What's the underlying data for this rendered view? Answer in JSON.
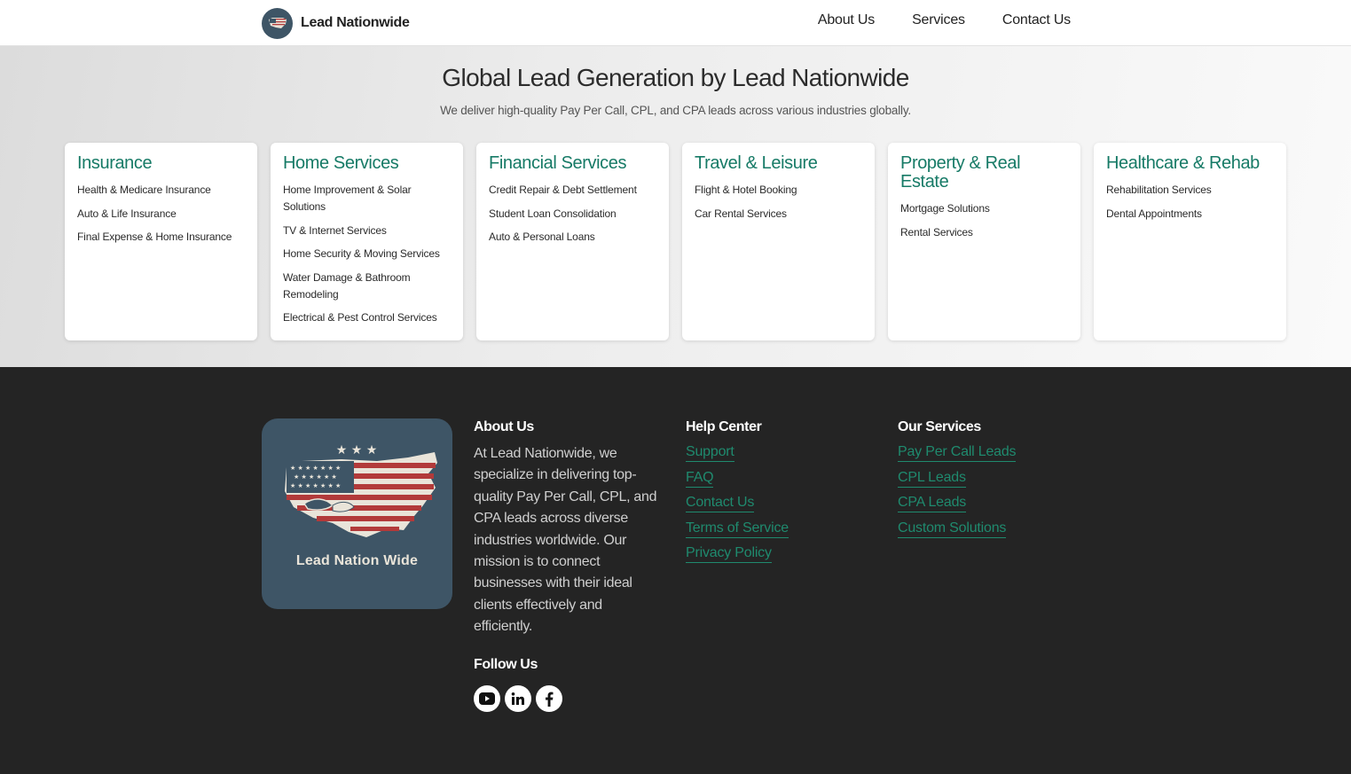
{
  "header": {
    "brand": "Lead Nationwide",
    "nav": [
      "About Us",
      "Services",
      "Contact Us"
    ]
  },
  "hero": {
    "title": "Global Lead Generation by Lead Nationwide",
    "subtitle": "We deliver high-quality Pay Per Call, CPL, and CPA leads across various industries globally."
  },
  "cards": [
    {
      "title": "Insurance",
      "items": [
        "Health & Medicare Insurance",
        "Auto & Life Insurance",
        "Final Expense & Home Insurance"
      ]
    },
    {
      "title": "Home Services",
      "items": [
        "Home Improvement & Solar Solutions",
        "TV & Internet Services",
        "Home Security & Moving Services",
        "Water Damage & Bathroom Remodeling",
        "Electrical & Pest Control Services"
      ]
    },
    {
      "title": "Financial Services",
      "items": [
        "Credit Repair & Debt Settlement",
        "Student Loan Consolidation",
        "Auto & Personal Loans"
      ]
    },
    {
      "title": "Travel & Leisure",
      "items": [
        "Flight & Hotel Booking",
        "Car Rental Services"
      ]
    },
    {
      "title": "Property & Real Estate",
      "items": [
        "Mortgage Solutions",
        "Rental Services"
      ]
    },
    {
      "title": "Healthcare & Rehab",
      "items": [
        "Rehabilitation Services",
        "Dental Appointments"
      ]
    }
  ],
  "footer": {
    "logo_text": "Lead Nation Wide",
    "about": {
      "heading": "About Us",
      "text": "At Lead Nationwide, we specialize in delivering top-quality Pay Per Call, CPL, and CPA leads across diverse industries worldwide. Our mission is to connect businesses with their ideal clients effectively and efficiently."
    },
    "help": {
      "heading": "Help Center",
      "links": [
        "Support",
        "FAQ",
        "Contact Us",
        "Terms of Service",
        "Privacy Policy"
      ]
    },
    "services": {
      "heading": "Our Services",
      "links": [
        "Pay Per Call Leads",
        "CPL Leads",
        "CPA Leads",
        "Custom Solutions"
      ]
    },
    "follow": {
      "heading": "Follow Us",
      "icons": [
        "youtube-icon",
        "linkedin-icon",
        "facebook-icon"
      ]
    }
  },
  "colors": {
    "accent": "#167a66",
    "footer_bg": "#242424",
    "logo_bg": "#3e5566"
  }
}
